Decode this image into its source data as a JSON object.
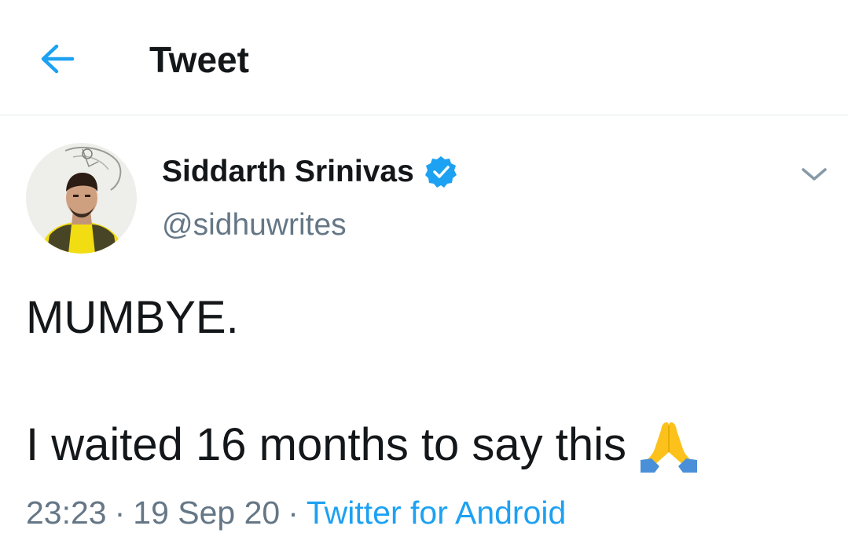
{
  "header": {
    "title": "Tweet",
    "back_icon": "arrow-left-icon"
  },
  "tweet": {
    "author": {
      "display_name": "Siddarth Srinivas",
      "handle": "@sidhuwrites",
      "verified": true,
      "verified_icon": "verified-badge-icon"
    },
    "menu_icon": "chevron-down-icon",
    "text_line1": "MUMBYE.",
    "text_line2": "I waited 16 months to say this",
    "emoji_icon": "folded-hands-emoji-icon",
    "time": "23:23",
    "date": "19 Sep 20",
    "source": "Twitter for Android",
    "separator": "·"
  },
  "colors": {
    "accent": "#1da1f2",
    "secondary_text": "#657786",
    "primary_text": "#14171a",
    "divider": "#e1e8ed"
  }
}
